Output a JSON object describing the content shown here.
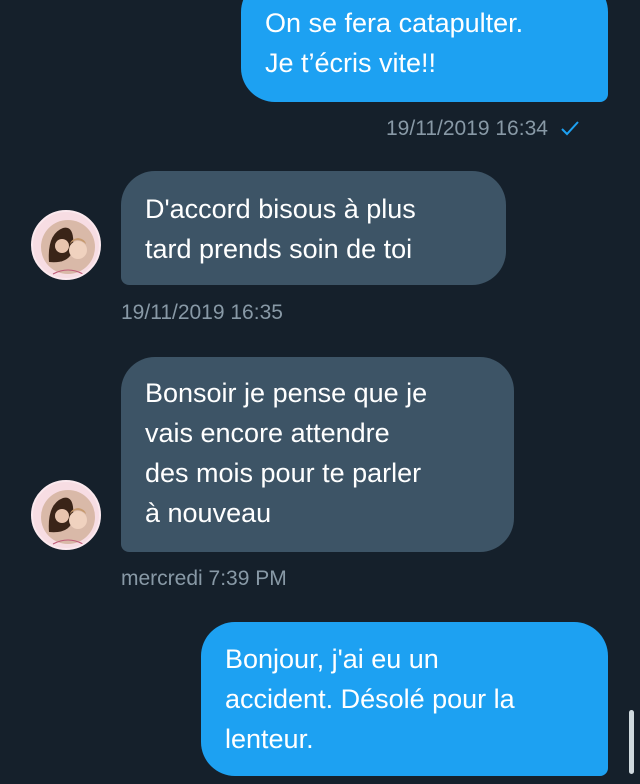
{
  "messages": [
    {
      "direction": "outgoing",
      "lines": [
        "On se fera catapulter.",
        "Je t’écris vite!!"
      ],
      "timestamp": "19/11/2019 16:34",
      "status_icon": "check-icon"
    },
    {
      "direction": "incoming",
      "lines": [
        "D'accord bisous à plus",
        "tard prends soin de toi"
      ],
      "timestamp": "19/11/2019 16:35",
      "avatar": "contact-avatar"
    },
    {
      "direction": "incoming",
      "lines": [
        "Bonsoir je pense que je",
        "vais encore attendre",
        "des mois pour te parler",
        "à nouveau"
      ],
      "timestamp": "mercredi 7:39 PM",
      "avatar": "contact-avatar"
    },
    {
      "direction": "outgoing",
      "lines": [
        "Bonjour, j'ai eu un",
        "accident. Désolé pour la",
        "lenteur."
      ]
    }
  ],
  "colors": {
    "background": "#15202b",
    "outgoing_bubble": "#1da1f2",
    "incoming_bubble": "#3d5466",
    "meta_text": "#8899a6"
  }
}
